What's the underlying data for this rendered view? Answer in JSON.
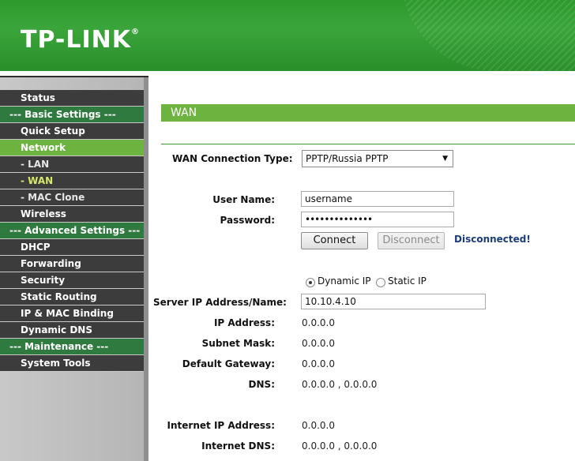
{
  "header": {
    "logo": "TP-LINK",
    "logo_mark": "®"
  },
  "sidebar": {
    "items": [
      {
        "label": "Status",
        "kind": "dark"
      },
      {
        "label": "--- Basic Settings ---",
        "kind": "section"
      },
      {
        "label": "Quick Setup",
        "kind": "dark"
      },
      {
        "label": "Network",
        "kind": "active"
      },
      {
        "label": "- LAN",
        "kind": "sub"
      },
      {
        "label": "- WAN",
        "kind": "sub-current"
      },
      {
        "label": "- MAC Clone",
        "kind": "sub"
      },
      {
        "label": "Wireless",
        "kind": "dark"
      },
      {
        "label": "--- Advanced Settings ---",
        "kind": "section"
      },
      {
        "label": "DHCP",
        "kind": "dark"
      },
      {
        "label": "Forwarding",
        "kind": "dark"
      },
      {
        "label": "Security",
        "kind": "dark"
      },
      {
        "label": "Static Routing",
        "kind": "dark"
      },
      {
        "label": "IP & MAC Binding",
        "kind": "dark"
      },
      {
        "label": "Dynamic DNS",
        "kind": "dark"
      },
      {
        "label": "--- Maintenance ---",
        "kind": "section"
      },
      {
        "label": "System Tools",
        "kind": "dark"
      }
    ]
  },
  "page": {
    "title": "WAN"
  },
  "form": {
    "wan_type_label": "WAN Connection Type:",
    "wan_type_value": "PPTP/Russia PPTP",
    "username_label": "User Name:",
    "username_value": "username",
    "password_label": "Password:",
    "password_value": "••••••••••••••",
    "connect_label": "Connect",
    "disconnect_label": "Disconnect",
    "status_text": "Disconnected!",
    "radio_dynamic": "Dynamic IP",
    "radio_static": "Static IP",
    "server_label": "Server IP Address/Name:",
    "server_value": "10.10.4.10",
    "ip_label": "IP Address:",
    "ip_value": "0.0.0.0",
    "mask_label": "Subnet Mask:",
    "mask_value": "0.0.0.0",
    "gateway_label": "Default Gateway:",
    "gateway_value": "0.0.0.0",
    "dns_label": "DNS:",
    "dns_value": "0.0.0.0 , 0.0.0.0",
    "inet_ip_label": "Internet IP Address:",
    "inet_ip_value": "0.0.0.0",
    "inet_dns_label": "Internet DNS:",
    "inet_dns_value": "0.0.0.0 , 0.0.0.0"
  }
}
